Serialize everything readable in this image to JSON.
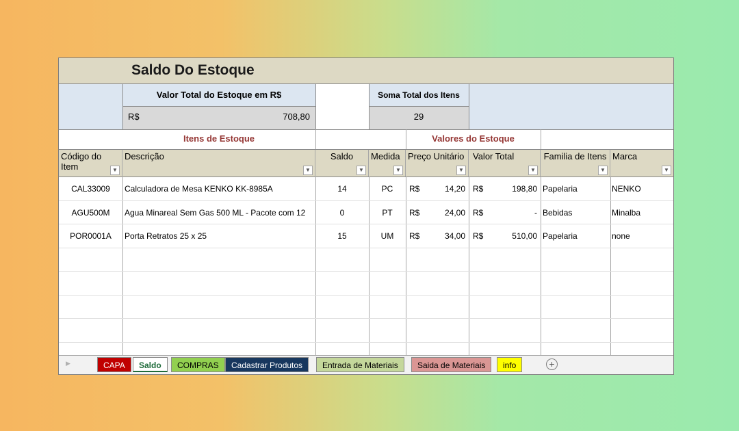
{
  "title": "Saldo Do Estoque",
  "summary": {
    "valor_total_label": "Valor Total do Estoque em R$",
    "valor_currency": "R$",
    "valor_total_value": "708,80",
    "soma_itens_label": "Soma Total dos Itens",
    "soma_itens_value": "29"
  },
  "sections": {
    "itens": "Itens de Estoque",
    "valores": "Valores do Estoque"
  },
  "columns": {
    "codigo": "Código do Item",
    "descricao": "Descrição",
    "saldo": "Saldo",
    "medida": "Medida",
    "preco": "Preço Unitário",
    "valor_total": "Valor Total",
    "familia": "Familia de Itens",
    "marca": "Marca"
  },
  "rows": [
    {
      "codigo": "CAL33009",
      "descricao": "Calculadora de Mesa KENKO KK-8985A",
      "saldo": "14",
      "medida": "PC",
      "preco_cur": "R$",
      "preco": "14,20",
      "total_cur": "R$",
      "total": "198,80",
      "familia": "Papelaria",
      "marca": "NENKO"
    },
    {
      "codigo": "AGU500M",
      "descricao": "Agua Minareal Sem Gas 500 ML -  Pacote com 12",
      "saldo": "0",
      "medida": "PT",
      "preco_cur": "R$",
      "preco": "24,00",
      "total_cur": "R$",
      "total": "-",
      "familia": "Bebidas",
      "marca": "Minalba"
    },
    {
      "codigo": "POR0001A",
      "descricao": "Porta Retratos 25 x 25",
      "saldo": "15",
      "medida": "UM",
      "preco_cur": "R$",
      "preco": "34,00",
      "total_cur": "R$",
      "total": "510,00",
      "familia": "Papelaria",
      "marca": "none"
    }
  ],
  "tabs": [
    {
      "label": "CAPA",
      "bg": "#c00000",
      "fg": "#ffffff"
    },
    {
      "label": "Saldo",
      "bg": "#ffffff",
      "fg": "#1e6b3a"
    },
    {
      "label": "COMPRAS",
      "bg": "#92d050",
      "fg": "#000000"
    },
    {
      "label": "Cadastrar Produtos",
      "bg": "#17375e",
      "fg": "#ffffff"
    },
    {
      "label": "Entrada de Materiais",
      "bg": "#c4d79b",
      "fg": "#000000"
    },
    {
      "label": "Saida de Materiais",
      "bg": "#da9694",
      "fg": "#000000"
    },
    {
      "label": "info",
      "bg": "#ffff00",
      "fg": "#000000"
    }
  ],
  "icons": {
    "scroll_left": "triangle-left-icon",
    "add_sheet": "plus-circle-icon"
  }
}
